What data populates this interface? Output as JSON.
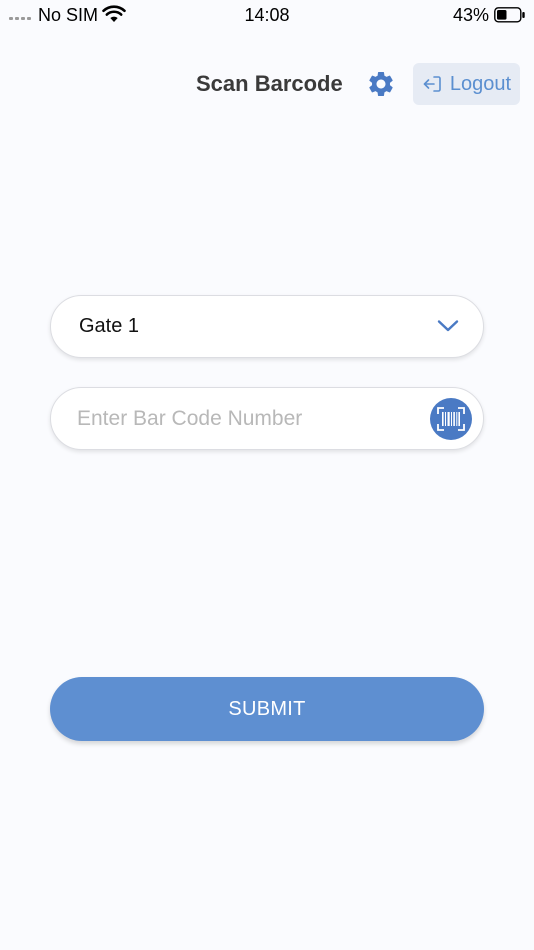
{
  "status_bar": {
    "carrier": "No SIM",
    "time": "14:08",
    "battery_percent": "43%",
    "battery_level": 0.43
  },
  "header": {
    "title": "Scan Barcode",
    "settings_icon": "gear-icon",
    "logout_label": "Logout",
    "logout_icon": "logout-icon"
  },
  "form": {
    "gate_selected": "Gate 1",
    "gate_icon": "chevron-down-icon",
    "barcode_value": "",
    "barcode_placeholder": "Enter Bar Code Number",
    "scan_icon": "barcode-scan-icon",
    "submit_label": "SUBMIT"
  },
  "colors": {
    "accent": "#5e8fd1",
    "scan_button": "#4a7ac4",
    "logout_bg": "#e6ebf4",
    "background": "#fafbfe"
  }
}
